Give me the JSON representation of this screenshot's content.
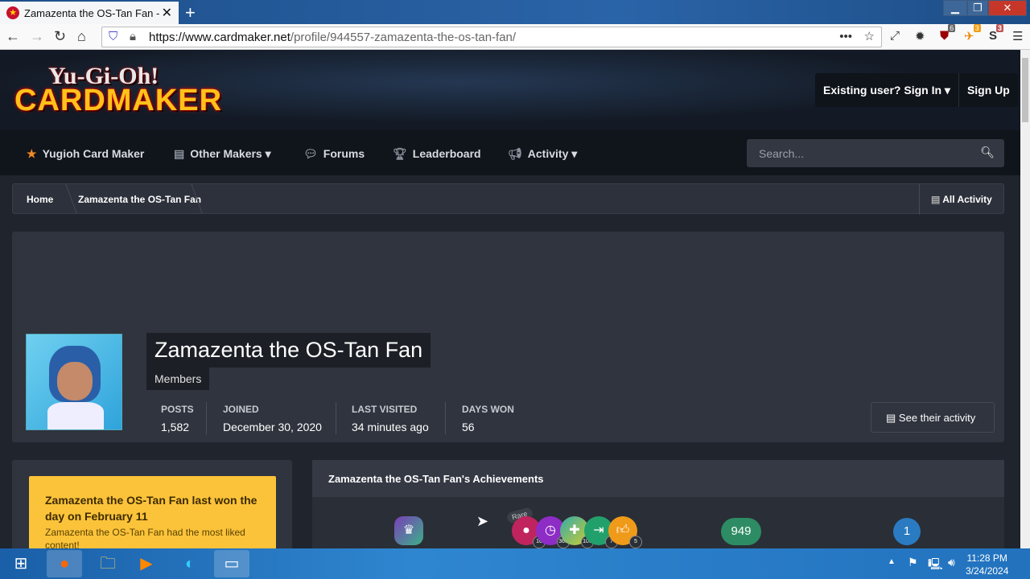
{
  "browser": {
    "tab_title": "Zamazenta the OS-Tan Fan - Yu",
    "url_host": "https://www.cardmaker.net",
    "url_path": "/profile/944557-zamazenta-the-os-tan-fan/",
    "ext_badges": [
      "6",
      "3",
      "3"
    ]
  },
  "site": {
    "logo_top": "Yu-Gi-Oh!",
    "logo_bottom": "CARDMAKER",
    "sign_in": "Existing user? Sign In",
    "sign_up": "Sign Up",
    "nav": [
      "Yugioh Card Maker",
      "Other Makers",
      "Forums",
      "Leaderboard",
      "Activity"
    ],
    "search_placeholder": "Search..."
  },
  "breadcrumb": {
    "home": "Home",
    "current": "Zamazenta the OS-Tan Fan",
    "all_activity": "All Activity"
  },
  "profile": {
    "name": "Zamazenta the OS-Tan Fan",
    "group": "Members",
    "stats": [
      {
        "label": "POSTS",
        "value": "1,582"
      },
      {
        "label": "JOINED",
        "value": "December 30, 2020"
      },
      {
        "label": "LAST VISITED",
        "value": "34 minutes ago"
      },
      {
        "label": "DAYS WON",
        "value": "56"
      }
    ],
    "see_activity": "See their activity"
  },
  "day_won": {
    "heading": "Zamazenta the OS-Tan Fan last won the day on February 11",
    "text": "Zamazenta the OS-Tan Fan had the most liked content!"
  },
  "achievements": {
    "title": "Zamazenta the OS-Tan Fan's Achievements",
    "rare_label": "Rare",
    "badge_counts": [
      "10",
      "365",
      "100",
      "7",
      "5"
    ],
    "reputation": "949",
    "rank": "1"
  },
  "taskbar": {
    "time": "11:28 PM",
    "date": "3/24/2024"
  }
}
